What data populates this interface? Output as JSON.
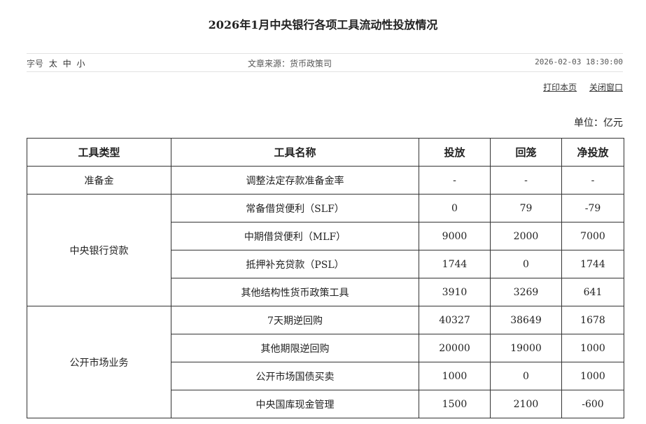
{
  "page": {
    "title": "2026年1月中央银行各项工具流动性投放情况",
    "font_size_label": "字号",
    "font_sizes": [
      "太",
      "中",
      "小"
    ],
    "source": "文章来源：货币政策司",
    "datetime": "2026-02-03 18:30:00",
    "print_label": "打印本页",
    "close_label": "关闭窗口",
    "unit": "单位：亿元"
  },
  "table": {
    "headers": [
      "工具类型",
      "工具名称",
      "投放",
      "回笼",
      "净投放"
    ],
    "groups": [
      {
        "type": "准备金",
        "rows": [
          {
            "name": "调整法定存款准备金率",
            "release": "-",
            "withdraw": "-",
            "net": "-"
          }
        ]
      },
      {
        "type": "中央银行贷款",
        "rows": [
          {
            "name": "常备借贷便利（SLF）",
            "release": "0",
            "withdraw": "79",
            "net": "-79"
          },
          {
            "name": "中期借贷便利（MLF）",
            "release": "9000",
            "withdraw": "2000",
            "net": "7000"
          },
          {
            "name": "抵押补充贷款（PSL）",
            "release": "1744",
            "withdraw": "0",
            "net": "1744"
          },
          {
            "name": "其他结构性货币政策工具",
            "release": "3910",
            "withdraw": "3269",
            "net": "641"
          }
        ]
      },
      {
        "type": "公开市场业务",
        "rows": [
          {
            "name": "7天期逆回购",
            "release": "40327",
            "withdraw": "38649",
            "net": "1678"
          },
          {
            "name": "其他期限逆回购",
            "release": "20000",
            "withdraw": "19000",
            "net": "1000"
          },
          {
            "name": "公开市场国债买卖",
            "release": "1000",
            "withdraw": "0",
            "net": "1000"
          },
          {
            "name": "中央国库现金管理",
            "release": "1500",
            "withdraw": "2100",
            "net": "-600"
          }
        ]
      }
    ]
  }
}
